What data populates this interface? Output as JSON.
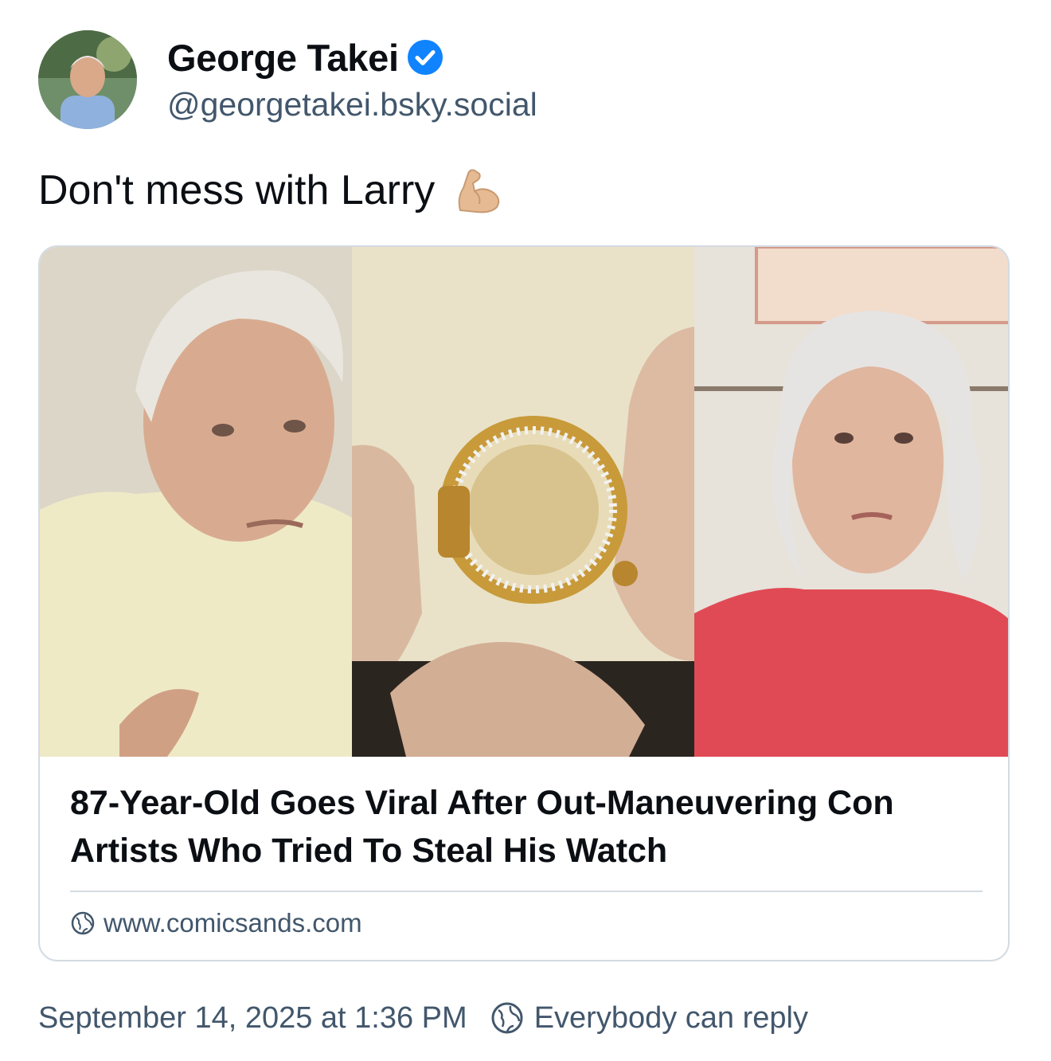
{
  "author": {
    "display_name": "George Takei",
    "handle": "@georgetakei.bsky.social",
    "verified": true,
    "avatar_icon": "avatar-photo"
  },
  "post": {
    "text": "Don't mess with Larry",
    "emoji_icon": "flexed-biceps-icon"
  },
  "link_card": {
    "image_description_icon": "thumbnail-image",
    "title": "87-Year-Old Goes Viral After Out-Maneuvering Con Artists Who Tried To Steal His Watch",
    "domain": "www.comicsands.com",
    "domain_icon": "globe-icon"
  },
  "footer": {
    "timestamp": "September 14, 2025 at 1:36 PM",
    "reply_setting": "Everybody can reply",
    "reply_icon": "globe-icon"
  },
  "colors": {
    "verified_blue": "#1083fe",
    "muted_text": "#42576c",
    "border": "#d4dbe2"
  }
}
